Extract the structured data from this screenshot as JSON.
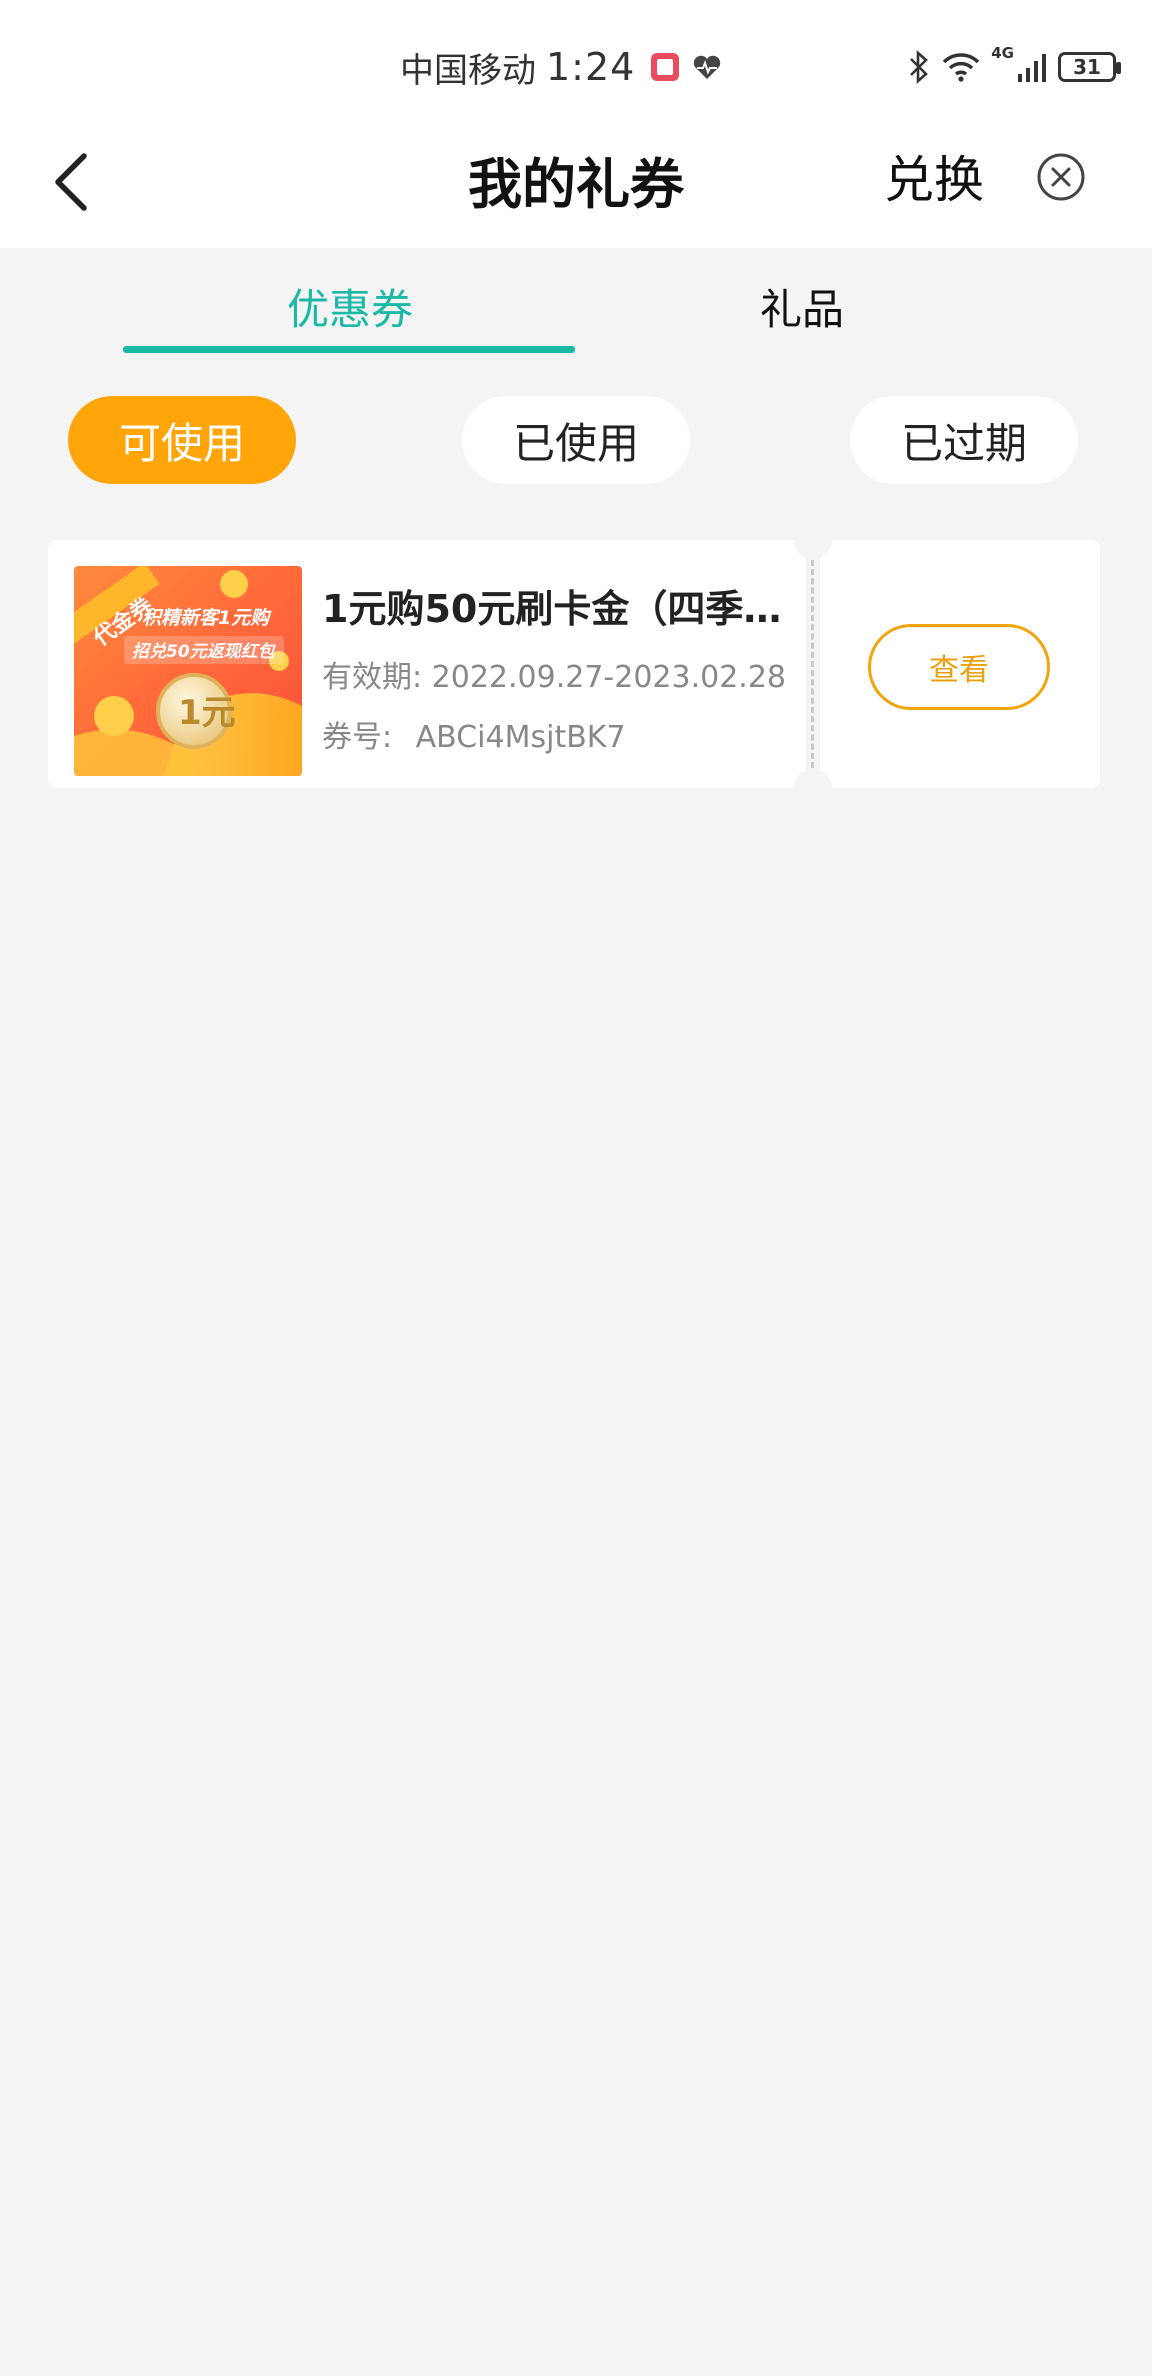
{
  "status_bar": {
    "carrier": "中国移动",
    "time": "1:24",
    "network": "4G",
    "battery": "31",
    "icons": [
      "note-icon",
      "heart-rate-icon",
      "bluetooth-icon",
      "wifi-icon",
      "signal-icon",
      "battery-icon"
    ]
  },
  "header": {
    "title": "我的礼券",
    "exchange_label": "兑换",
    "icons": [
      "back-arrow-icon",
      "close-circle-icon"
    ]
  },
  "tabs": {
    "items": [
      {
        "label": "优惠券",
        "active": true
      },
      {
        "label": "礼品",
        "active": false
      }
    ],
    "active_color": "#1bb8a6"
  },
  "filters": {
    "items": [
      {
        "label": "可使用",
        "active": true
      },
      {
        "label": "已使用",
        "active": false
      },
      {
        "label": "已过期",
        "active": false
      }
    ],
    "active_color": "#ffa50a"
  },
  "coupons": [
    {
      "title": "1元购50元刷卡金（四季…",
      "validity_label": "有效期:",
      "validity_value": "2022.09.27-2023.02.28",
      "code_label": "券号:",
      "code_value": "ABCi4MsjtBK7",
      "action_label": "查看",
      "thumbnail": {
        "ribbon": "代金券",
        "headline": "积精新客1元购",
        "subline": "招兑50元返现红包",
        "coin": "1元"
      }
    }
  ],
  "colors": {
    "background": "#f4f4f4",
    "accent_teal": "#1bb8a6",
    "accent_orange": "#ffa50a"
  }
}
